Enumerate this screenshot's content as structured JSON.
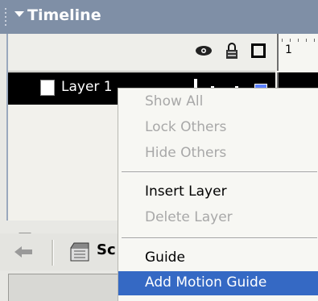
{
  "panel": {
    "title": "Timeline"
  },
  "timeline": {
    "frame_number": "1",
    "layer": {
      "name": "Layer 1",
      "swatch_color": "#5a7fff"
    }
  },
  "lower_bar": {
    "scene_label": "Sc"
  },
  "context_menu": {
    "items": [
      {
        "label": "Show All",
        "state": "disabled"
      },
      {
        "label": "Lock Others",
        "state": "disabled"
      },
      {
        "label": "Hide Others",
        "state": "disabled"
      },
      {
        "label": "Insert Layer",
        "state": "enabled"
      },
      {
        "label": "Delete Layer",
        "state": "disabled"
      },
      {
        "label": "Guide",
        "state": "enabled"
      },
      {
        "label": "Add Motion Guide",
        "state": "highlighted"
      }
    ],
    "highlight_color": "#3569c4"
  }
}
